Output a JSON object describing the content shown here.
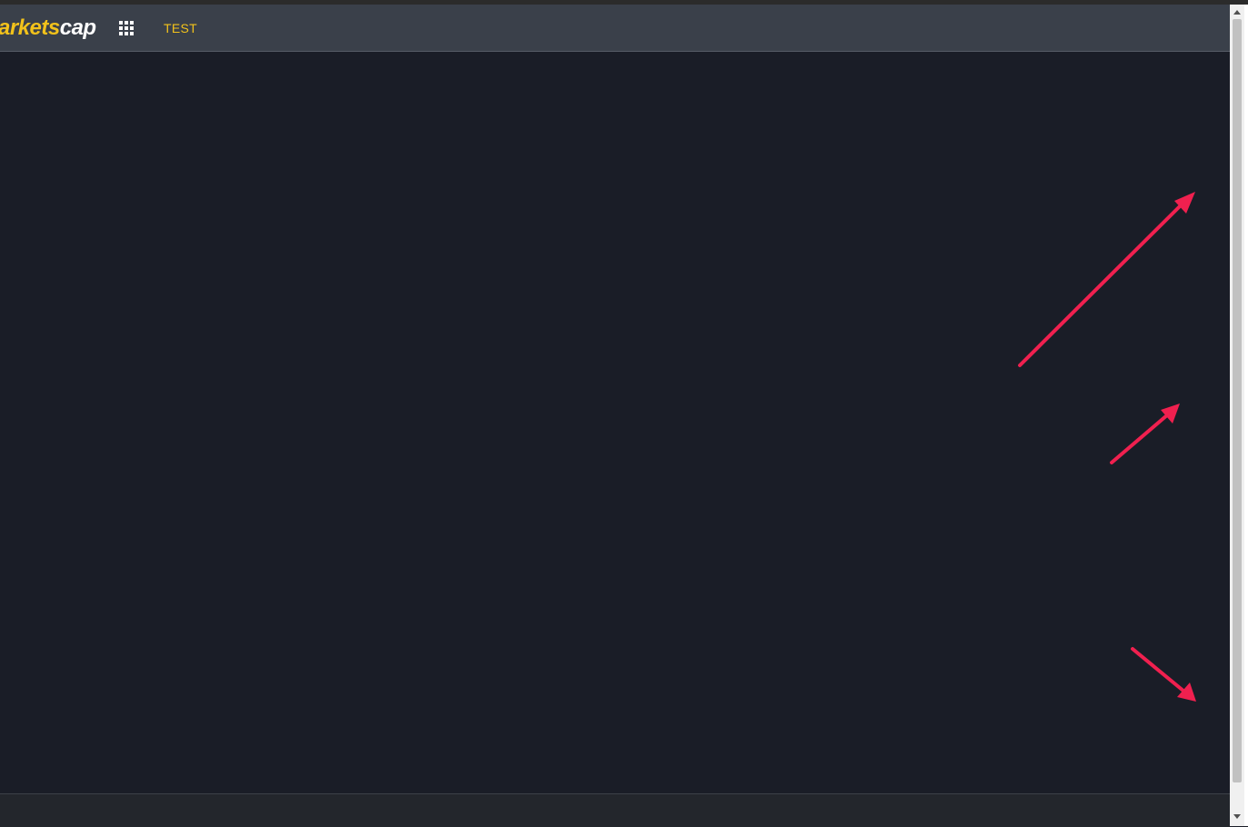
{
  "header": {
    "logo_part1": "arkets",
    "logo_part2": "cap",
    "apps_icon": "grid-icon",
    "nav_test_label": "TEST"
  },
  "colors": {
    "accent": "#f2c21b",
    "background": "#1a1d27",
    "header_bg": "#3a404a",
    "footer_bg": "#23262c",
    "annotation_arrow": "#f0204f"
  },
  "annotations": {
    "arrow_count": 3,
    "arrow_icon": "arrow-icon"
  }
}
